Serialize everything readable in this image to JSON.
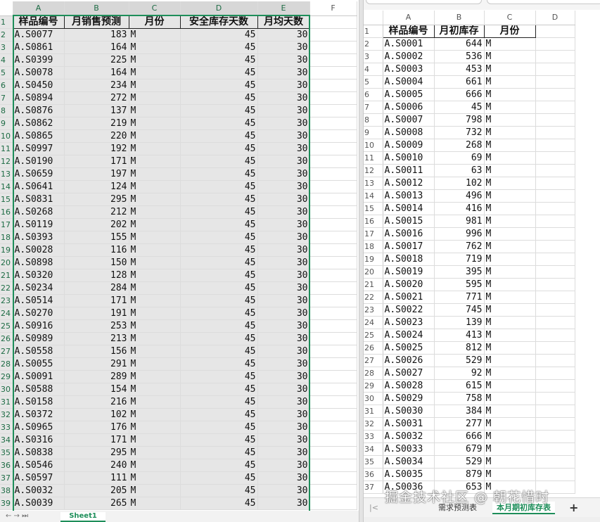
{
  "left_sheet": {
    "col_letters": [
      "A",
      "B",
      "C",
      "D",
      "E",
      "F"
    ],
    "headers": [
      "样品编号",
      "月销售预测",
      "月份",
      "安全库存天数",
      "月均天数"
    ],
    "rows": [
      [
        "A.S0077",
        "183",
        "M",
        "45",
        "30"
      ],
      [
        "A.S0861",
        "164",
        "M",
        "45",
        "30"
      ],
      [
        "A.S0399",
        "225",
        "M",
        "45",
        "30"
      ],
      [
        "A.S0078",
        "164",
        "M",
        "45",
        "30"
      ],
      [
        "A.S0450",
        "234",
        "M",
        "45",
        "30"
      ],
      [
        "A.S0894",
        "272",
        "M",
        "45",
        "30"
      ],
      [
        "A.S0876",
        "137",
        "M",
        "45",
        "30"
      ],
      [
        "A.S0862",
        "219",
        "M",
        "45",
        "30"
      ],
      [
        "A.S0865",
        "220",
        "M",
        "45",
        "30"
      ],
      [
        "A.S0997",
        "192",
        "M",
        "45",
        "30"
      ],
      [
        "A.S0190",
        "171",
        "M",
        "45",
        "30"
      ],
      [
        "A.S0659",
        "197",
        "M",
        "45",
        "30"
      ],
      [
        "A.S0641",
        "124",
        "M",
        "45",
        "30"
      ],
      [
        "A.S0831",
        "295",
        "M",
        "45",
        "30"
      ],
      [
        "A.S0268",
        "212",
        "M",
        "45",
        "30"
      ],
      [
        "A.S0119",
        "202",
        "M",
        "45",
        "30"
      ],
      [
        "A.S0393",
        "155",
        "M",
        "45",
        "30"
      ],
      [
        "A.S0028",
        "116",
        "M",
        "45",
        "30"
      ],
      [
        "A.S0898",
        "150",
        "M",
        "45",
        "30"
      ],
      [
        "A.S0320",
        "128",
        "M",
        "45",
        "30"
      ],
      [
        "A.S0234",
        "284",
        "M",
        "45",
        "30"
      ],
      [
        "A.S0514",
        "171",
        "M",
        "45",
        "30"
      ],
      [
        "A.S0270",
        "191",
        "M",
        "45",
        "30"
      ],
      [
        "A.S0916",
        "253",
        "M",
        "45",
        "30"
      ],
      [
        "A.S0989",
        "213",
        "M",
        "45",
        "30"
      ],
      [
        "A.S0558",
        "156",
        "M",
        "45",
        "30"
      ],
      [
        "A.S0055",
        "291",
        "M",
        "45",
        "30"
      ],
      [
        "A.S0091",
        "289",
        "M",
        "45",
        "30"
      ],
      [
        "A.S0588",
        "154",
        "M",
        "45",
        "30"
      ],
      [
        "A.S0158",
        "216",
        "M",
        "45",
        "30"
      ],
      [
        "A.S0372",
        "102",
        "M",
        "45",
        "30"
      ],
      [
        "A.S0965",
        "176",
        "M",
        "45",
        "30"
      ],
      [
        "A.S0316",
        "171",
        "M",
        "45",
        "30"
      ],
      [
        "A.S0838",
        "295",
        "M",
        "45",
        "30"
      ],
      [
        "A.S0546",
        "240",
        "M",
        "45",
        "30"
      ],
      [
        "A.S0597",
        "111",
        "M",
        "45",
        "30"
      ],
      [
        "A.S0032",
        "205",
        "M",
        "45",
        "30"
      ],
      [
        "A.S0039",
        "265",
        "M",
        "45",
        "30"
      ]
    ],
    "sheet_tab": "Sheet1",
    "nav_glyphs": "←  →  ⏭"
  },
  "right_sheet": {
    "col_letters": [
      "A",
      "B",
      "C",
      "D"
    ],
    "headers": [
      "样品编号",
      "月初库存",
      "月份"
    ],
    "rows": [
      [
        "A.S0001",
        "644",
        "M"
      ],
      [
        "A.S0002",
        "536",
        "M"
      ],
      [
        "A.S0003",
        "453",
        "M"
      ],
      [
        "A.S0004",
        "661",
        "M"
      ],
      [
        "A.S0005",
        "666",
        "M"
      ],
      [
        "A.S0006",
        "45",
        "M"
      ],
      [
        "A.S0007",
        "798",
        "M"
      ],
      [
        "A.S0008",
        "732",
        "M"
      ],
      [
        "A.S0009",
        "268",
        "M"
      ],
      [
        "A.S0010",
        "69",
        "M"
      ],
      [
        "A.S0011",
        "63",
        "M"
      ],
      [
        "A.S0012",
        "102",
        "M"
      ],
      [
        "A.S0013",
        "496",
        "M"
      ],
      [
        "A.S0014",
        "416",
        "M"
      ],
      [
        "A.S0015",
        "981",
        "M"
      ],
      [
        "A.S0016",
        "996",
        "M"
      ],
      [
        "A.S0017",
        "762",
        "M"
      ],
      [
        "A.S0018",
        "719",
        "M"
      ],
      [
        "A.S0019",
        "395",
        "M"
      ],
      [
        "A.S0020",
        "595",
        "M"
      ],
      [
        "A.S0021",
        "771",
        "M"
      ],
      [
        "A.S0022",
        "745",
        "M"
      ],
      [
        "A.S0023",
        "139",
        "M"
      ],
      [
        "A.S0024",
        "413",
        "M"
      ],
      [
        "A.S0025",
        "812",
        "M"
      ],
      [
        "A.S0026",
        "529",
        "M"
      ],
      [
        "A.S0027",
        "92",
        "M"
      ],
      [
        "A.S0028",
        "615",
        "M"
      ],
      [
        "A.S0029",
        "758",
        "M"
      ],
      [
        "A.S0030",
        "384",
        "M"
      ],
      [
        "A.S0031",
        "277",
        "M"
      ],
      [
        "A.S0032",
        "666",
        "M"
      ],
      [
        "A.S0033",
        "679",
        "M"
      ],
      [
        "A.S0034",
        "529",
        "M"
      ],
      [
        "A.S0035",
        "879",
        "M"
      ],
      [
        "A.S0036",
        "653",
        "M"
      ]
    ],
    "tabs": [
      "需求预测表",
      "本月期初库存表"
    ],
    "first_sheet_glyph": "|<",
    "add_sheet": "+"
  },
  "watermark": "掘金技术社区 @ 朝花惜时",
  "colors": {
    "accent": "#1e8e5a",
    "selection": "#e6e6e6",
    "gridline": "#dcdcdc"
  }
}
